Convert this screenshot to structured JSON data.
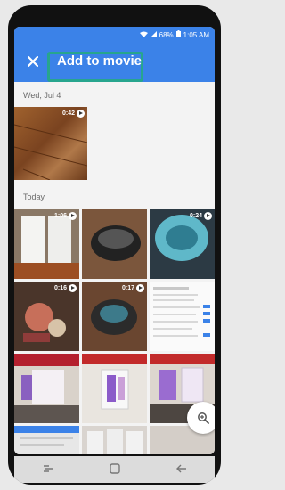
{
  "status_bar": {
    "battery": "68%",
    "time": "1:05 AM"
  },
  "app_bar": {
    "close_icon": "close-icon",
    "title": "Add to movie",
    "highlight_color": "#27a58e"
  },
  "sections": [
    {
      "label": "Wed, Jul 4",
      "items": [
        {
          "type": "video",
          "duration": "0:42",
          "thumbnail": "wood-floor"
        }
      ]
    },
    {
      "label": "Today",
      "items": [
        {
          "type": "video",
          "duration": "1:06",
          "thumbnail": "patio-doors"
        },
        {
          "type": "photo",
          "thumbnail": "robot-vacuum"
        },
        {
          "type": "video",
          "duration": "0:24",
          "thumbnail": "robot-vacuum-top"
        },
        {
          "type": "video",
          "duration": "0:16",
          "thumbnail": "dog-toys"
        },
        {
          "type": "video",
          "duration": "0:17",
          "thumbnail": "robot-vacuum-floor"
        },
        {
          "type": "photo",
          "thumbnail": "webpage-screenshot"
        },
        {
          "type": "photo",
          "thumbnail": "galaxy-s9-display"
        },
        {
          "type": "photo",
          "thumbnail": "phone-box"
        },
        {
          "type": "photo",
          "thumbnail": "phones-display"
        }
      ]
    }
  ],
  "fab": {
    "icon": "zoom-icon"
  },
  "nav_bar": {
    "icons": [
      "recents-icon",
      "home-icon",
      "back-icon"
    ]
  },
  "colors": {
    "accent": "#3b82e8",
    "background": "#f3f3f3"
  }
}
